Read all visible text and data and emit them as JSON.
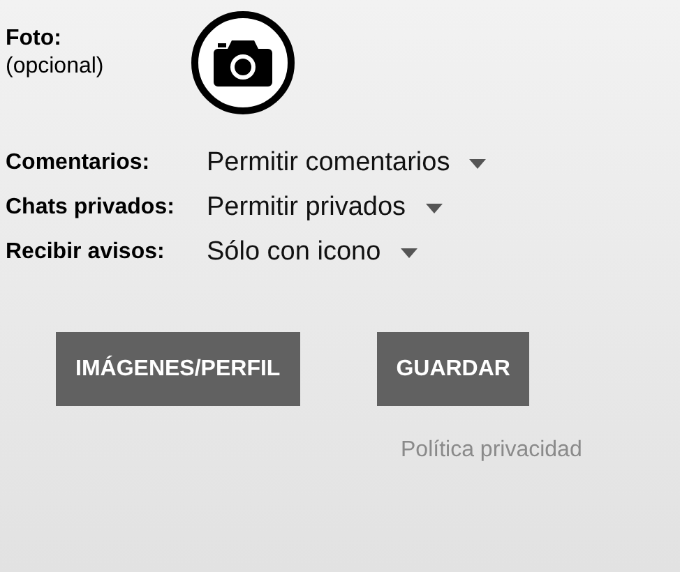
{
  "photo": {
    "label": "Foto:",
    "hint": "(opcional)"
  },
  "settings": [
    {
      "label": "Comentarios:",
      "value": "Permitir comentarios"
    },
    {
      "label": "Chats privados:",
      "value": "Permitir privados"
    },
    {
      "label": "Recibir avisos:",
      "value": "Sólo con icono"
    }
  ],
  "buttons": [
    "IMÁGENES/PERFIL",
    "GUARDAR"
  ],
  "privacy_link": "Política privacidad"
}
